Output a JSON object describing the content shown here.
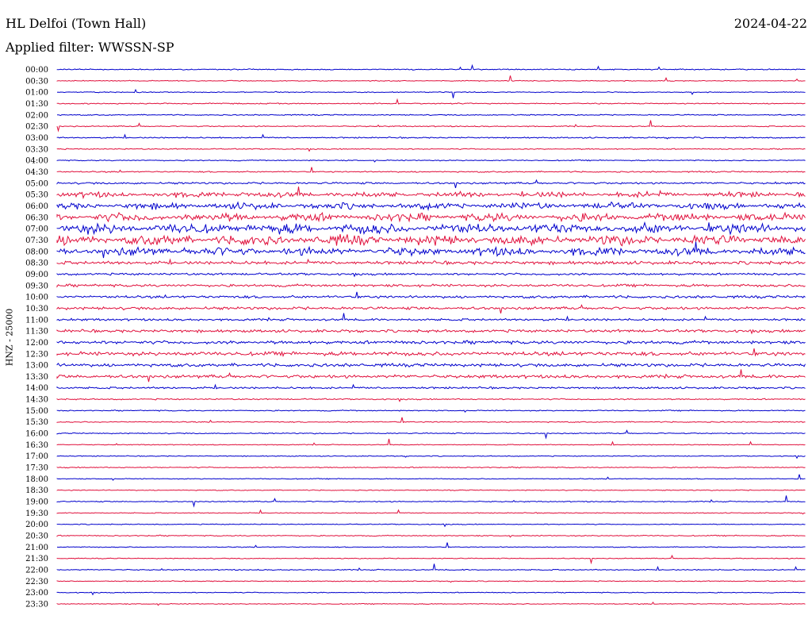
{
  "header": {
    "station": "HL Delfoi (Town Hall)",
    "date": "2024-04-22",
    "filter_label": "Applied filter: WWSSN-SP"
  },
  "chart_data": {
    "type": "line",
    "title": "HL Delfoi (Town Hall)",
    "ylabel": "HNZ - 25000",
    "row_labels": [
      "00:00",
      "00:30",
      "01:00",
      "01:30",
      "02:00",
      "02:30",
      "03:00",
      "03:30",
      "04:00",
      "04:30",
      "05:00",
      "05:30",
      "06:00",
      "06:30",
      "07:00",
      "07:30",
      "08:00",
      "08:30",
      "09:00",
      "09:30",
      "10:00",
      "10:30",
      "11:00",
      "11:30",
      "12:00",
      "12:30",
      "13:00",
      "13:30",
      "14:00",
      "14:30",
      "15:00",
      "15:30",
      "16:00",
      "16:30",
      "17:00",
      "17:30",
      "18:00",
      "18:30",
      "19:00",
      "19:30",
      "20:00",
      "20:30",
      "21:00",
      "21:30",
      "22:00",
      "22:30",
      "23:00",
      "23:30"
    ],
    "trace_colors": [
      "#0000cc",
      "#e0103c"
    ],
    "row_amplitude": [
      0.5,
      0.4,
      0.4,
      0.5,
      0.5,
      0.5,
      0.6,
      0.5,
      0.5,
      0.6,
      0.9,
      3.0,
      3.5,
      4.5,
      5.5,
      5.5,
      4.5,
      1.5,
      1.0,
      1.2,
      1.2,
      1.3,
      1.0,
      1.3,
      1.5,
      1.8,
      1.5,
      1.5,
      0.9,
      0.6,
      0.5,
      0.5,
      0.5,
      0.4,
      0.4,
      0.5,
      0.4,
      0.4,
      0.5,
      0.4,
      0.4,
      0.5,
      0.4,
      0.4,
      0.5,
      0.4,
      0.4,
      0.4
    ]
  }
}
